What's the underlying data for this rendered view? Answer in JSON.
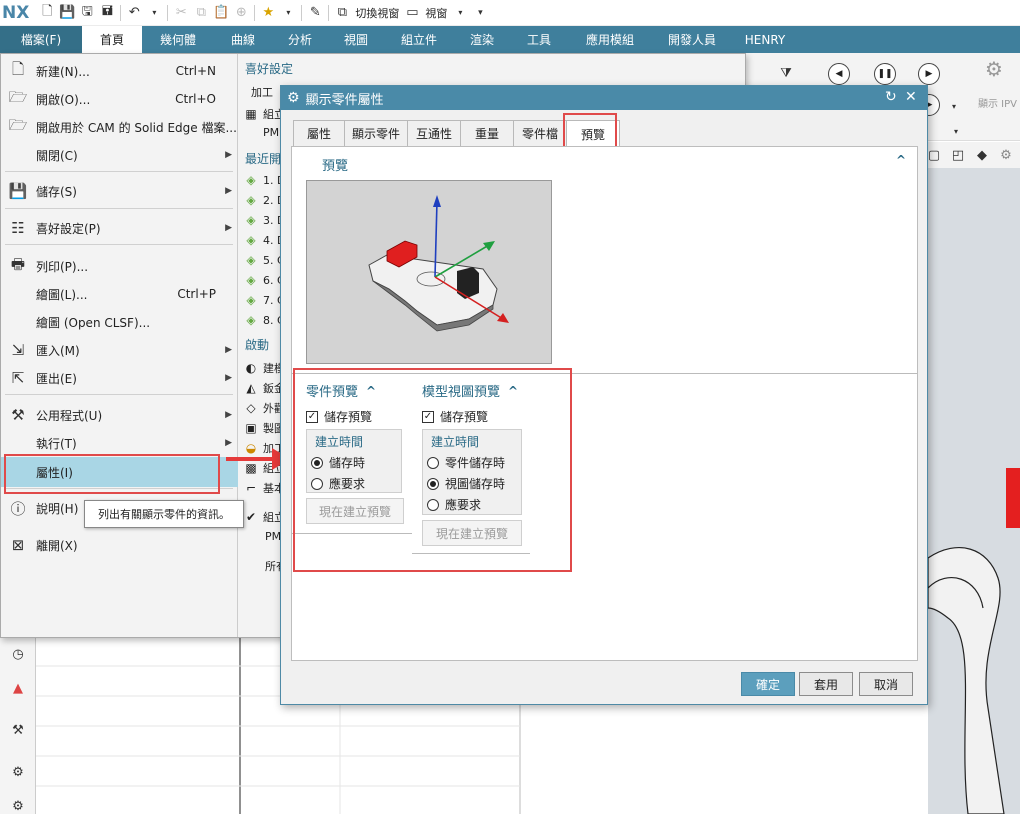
{
  "app": {
    "logo": "NX"
  },
  "quick_access": {
    "switch_view": "切換視窗",
    "window": "視窗"
  },
  "ribbon_tabs": [
    "檔案(F)",
    "首頁",
    "幾何體",
    "曲線",
    "分析",
    "視圖",
    "組立件",
    "渲染",
    "工具",
    "應用模組",
    "開發人員",
    "HENRY"
  ],
  "ribbon_right": {
    "show_ipv": "顯示 IPV"
  },
  "file_menu": {
    "new": {
      "label": "新建(N)...",
      "shortcut": "Ctrl+N"
    },
    "open": {
      "label": "開啟(O)...",
      "shortcut": "Ctrl+O"
    },
    "open_se": {
      "label": "開啟用於 CAM 的 Solid Edge 檔案..."
    },
    "close": {
      "label": "關閉(C)"
    },
    "save": {
      "label": "儲存(S)"
    },
    "prefs": {
      "label": "喜好設定(P)"
    },
    "print": {
      "label": "列印(P)..."
    },
    "plot": {
      "label": "繪圖(L)...",
      "shortcut": "Ctrl+P"
    },
    "plot_clsf": {
      "label": "繪圖 (Open CLSF)..."
    },
    "import": {
      "label": "匯入(M)"
    },
    "export": {
      "label": "匯出(E)"
    },
    "utilities": {
      "label": "公用程式(U)"
    },
    "execute": {
      "label": "執行(T)"
    },
    "properties": {
      "label": "屬性(I)"
    },
    "help": {
      "label": "說明(H)"
    },
    "exit": {
      "label": "離開(X)"
    }
  },
  "file_right": {
    "pref_head": "喜好設定",
    "pref_items": [
      "加工",
      "組立",
      "PM"
    ],
    "recent_head": "最近開",
    "recent_items": [
      "1. D",
      "2. D",
      "3. D",
      "4. D",
      "5. C",
      "6. C",
      "7. C",
      "8. C"
    ],
    "start_head": "啟動",
    "start_items": [
      "建模",
      "鈑金",
      "外觀",
      "製圖",
      "加工",
      "組立",
      "基本"
    ],
    "bottom_items": [
      "組立",
      "PM",
      "所有"
    ]
  },
  "tooltip": "列出有關顯示零件的資訊。",
  "dialog": {
    "title": "顯示零件屬性",
    "tabs": [
      "屬性",
      "顯示零件",
      "互通性",
      "重量",
      "零件檔",
      "預覽"
    ],
    "preview_section": "預覽",
    "part_preview": {
      "title": "零件預覽",
      "save_preview": "儲存預覽",
      "create_time": "建立時間",
      "options": [
        "儲存時",
        "應要求"
      ],
      "selected": 0,
      "create_now": "現在建立預覽"
    },
    "model_view_preview": {
      "title": "模型視圖預覽",
      "save_preview": "儲存預覽",
      "create_time": "建立時間",
      "options": [
        "零件儲存時",
        "視圖儲存時",
        "應要求"
      ],
      "selected": 1,
      "create_now": "現在建立預覽"
    },
    "ok": "確定",
    "apply": "套用",
    "cancel": "取消"
  }
}
